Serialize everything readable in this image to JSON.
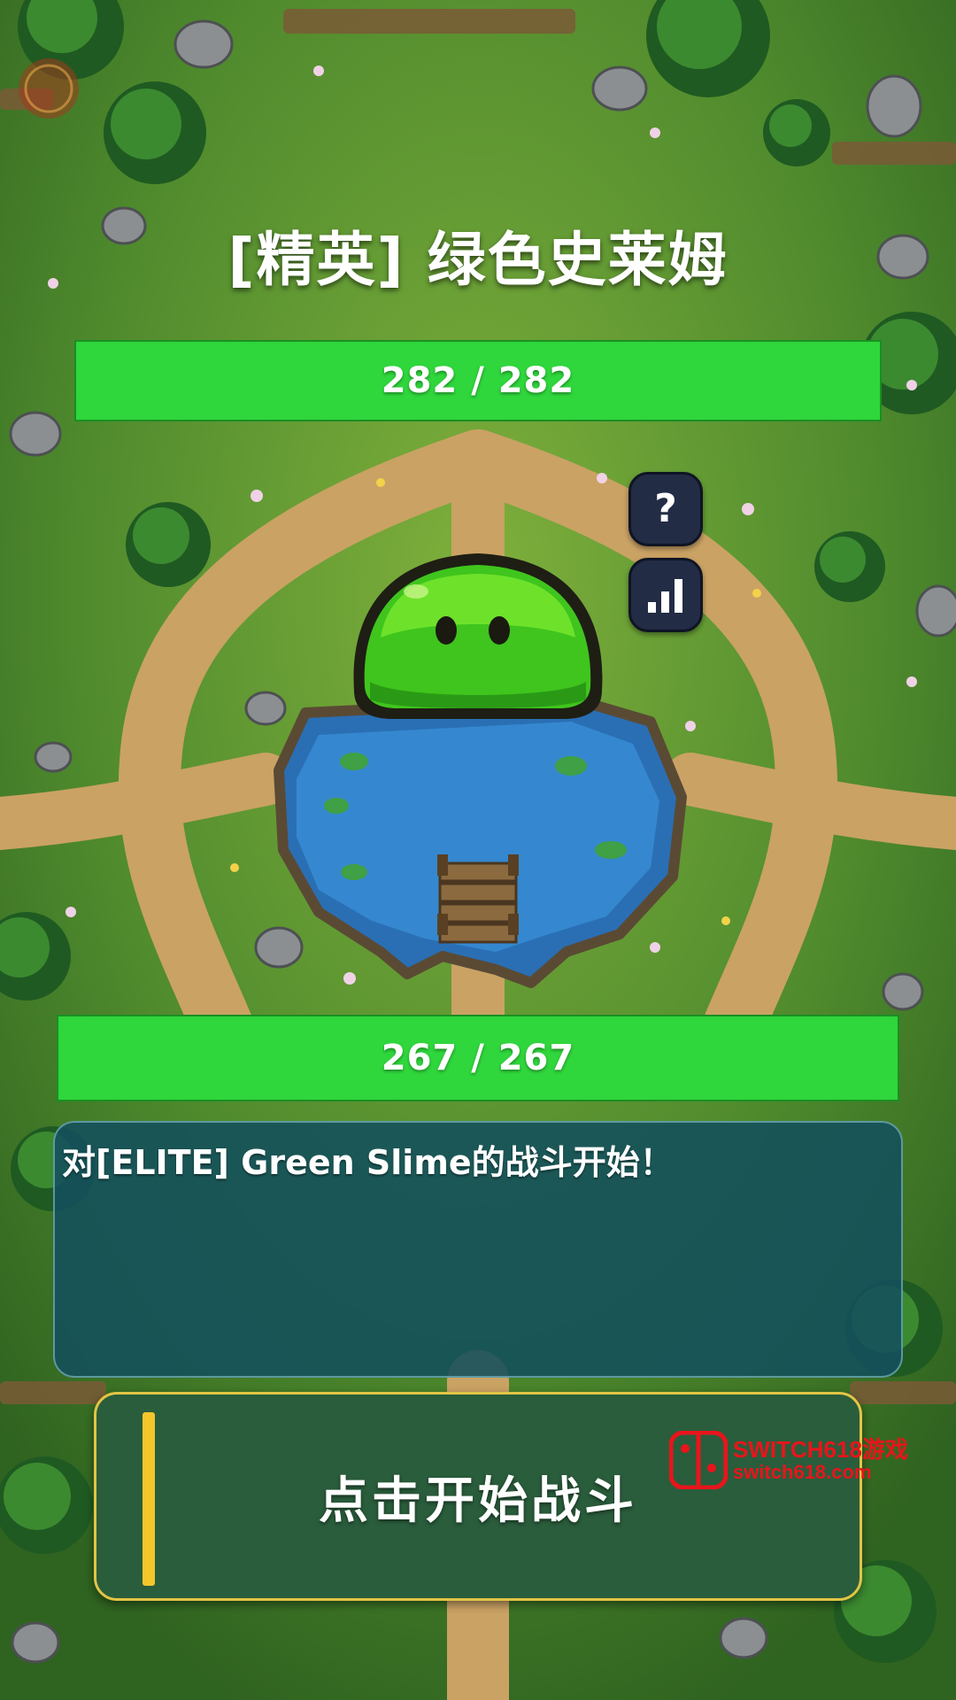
{
  "battle": {
    "enemy_name": "[精英] 绿色史莱姆",
    "enemy_hp": {
      "current": 282,
      "max": 282,
      "text": "282 / 282"
    },
    "player_hp": {
      "current": 267,
      "max": 267,
      "text": "267 / 267"
    }
  },
  "buttons": {
    "help_label": "?",
    "stats_icon": "bar-chart-icon",
    "start_label": "点击开始战斗"
  },
  "log": {
    "lines": [
      "对[ELITE] Green Slime的战斗开始！"
    ]
  },
  "watermark": {
    "title": "SWITCH618游戏",
    "subtitle": "switch618.com"
  },
  "colors": {
    "hp_bar": "#2fd63c",
    "button_dark": "#232c45",
    "log_panel": "#134e5c",
    "start_button": "#2a5d3c",
    "start_border": "#e2c545",
    "accent_yellow": "#f5c62a",
    "watermark_red": "#e8151b"
  }
}
